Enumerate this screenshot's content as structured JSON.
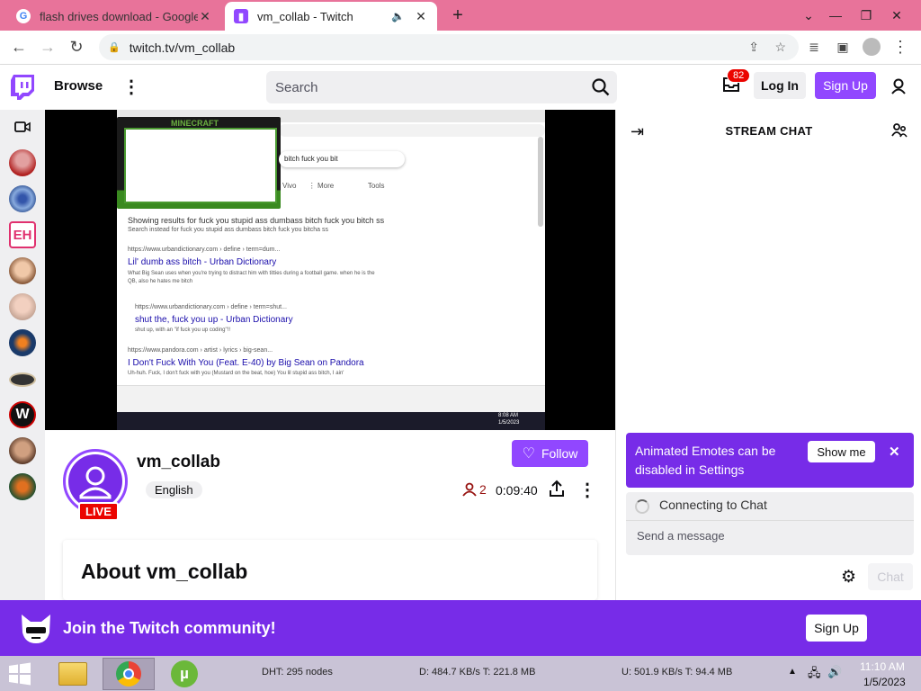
{
  "browser": {
    "tabs": [
      {
        "title": "flash drives download - Google Se",
        "icon": "google-icon",
        "active": false
      },
      {
        "title": "vm_collab - Twitch",
        "icon": "twitch-icon",
        "active": true
      }
    ],
    "address": "twitch.tv/vm_collab"
  },
  "twitch": {
    "browse_label": "Browse",
    "search_placeholder": "Search",
    "notification_count": "82",
    "login_label": "Log In",
    "signup_label": "Sign Up"
  },
  "video_screen": {
    "search_query": "bitch fuck you bit",
    "showing_results": "Showing results for fuck you stupid ass dumbass bitch fuck you bitch ss",
    "search_instead": "Search instead for fuck you stupid ass dumbass bitch fuck you bitcha ss",
    "results": [
      {
        "url": "https://www.urbandictionary.com › define › term=dum...",
        "title": "Lil' dumb ass bitch - Urban Dictionary",
        "snippet": "What Big Sean uses when you're trying to distract him with titties during a football game. when he is the QB, also he hates me bitch"
      },
      {
        "url": "https://www.urbandictionary.com › define › term=shut...",
        "title": "shut the, fuck you up - Urban Dictionary",
        "snippet": "shut up, with an \"if fuck you up coding\"!!"
      },
      {
        "url": "https://www.pandora.com › artist › lyrics › big-sean...",
        "title": "I Don't Fuck With You (Feat. E-40) by Big Sean on Pandora",
        "snippet": "Uh-huh. Fuck, I don't fuck with you (Mustard on the beat, hoe) You lil stupid ass bitch, I ain'"
      }
    ],
    "clock_time": "8:08 AM",
    "clock_date": "1/5/2023"
  },
  "channel": {
    "name": "vm_collab",
    "live_badge": "LIVE",
    "language_tag": "English",
    "follow_label": "Follow",
    "viewer_count": "2",
    "uptime": "0:09:40",
    "about_title": "About vm_collab"
  },
  "chat": {
    "title": "STREAM CHAT",
    "banner_text": "Animated Emotes can be disabled in Settings",
    "show_me_label": "Show me",
    "connecting_text": "Connecting to Chat",
    "input_placeholder": "Send a message",
    "send_label": "Chat"
  },
  "community": {
    "text": "Join the Twitch community!",
    "signup_label": "Sign Up"
  },
  "taskbar": {
    "dht": "DHT: 295 nodes",
    "download": "D: 484.7 KB/s T: 221.8 MB",
    "upload": "U: 501.9 KB/s T: 94.4 MB",
    "time": "11:10 AM",
    "date": "1/5/2023"
  },
  "colors": {
    "twitch_purple": "#9147ff",
    "footer_purple": "#772ce8",
    "live_red": "#eb0400",
    "titlebar_pink": "#e8739a"
  }
}
